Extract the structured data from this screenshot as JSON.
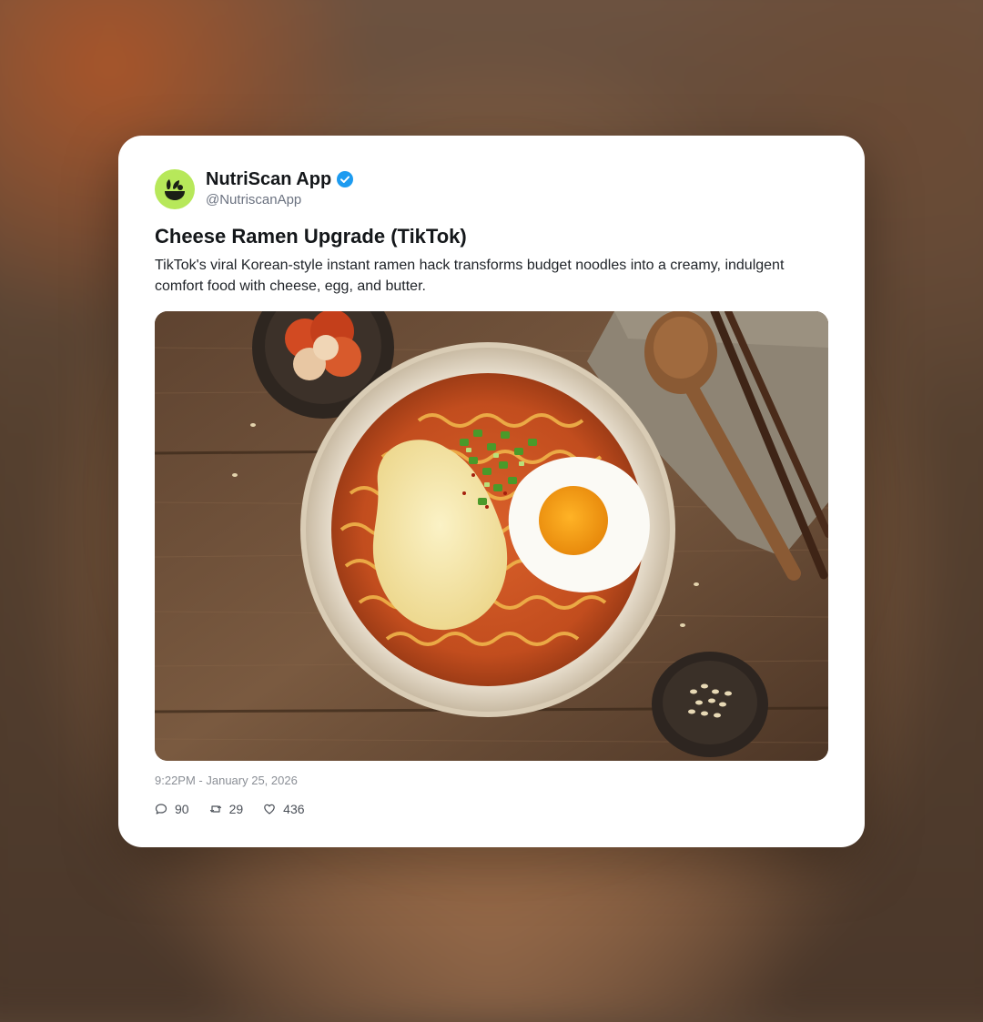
{
  "post": {
    "author": {
      "name": "NutriScan App",
      "handle": "@NutriscanApp",
      "verified": true,
      "avatar_color": "#b7e85a"
    },
    "title": "Cheese Ramen Upgrade (TikTok)",
    "body": "TikTok's viral Korean-style instant ramen hack transforms budget noodles into a creamy, indulgent comfort food with cheese, egg, and butter.",
    "timestamp": "9:22PM - January 25, 2026",
    "stats": {
      "replies": "90",
      "reposts": "29",
      "likes": "436"
    }
  },
  "icons": {
    "verified": "verified-badge-icon",
    "reply": "comment-icon",
    "repost": "repost-icon",
    "like": "heart-icon"
  },
  "colors": {
    "verified_blue": "#1d9bf0",
    "card_background": "#ffffff"
  }
}
